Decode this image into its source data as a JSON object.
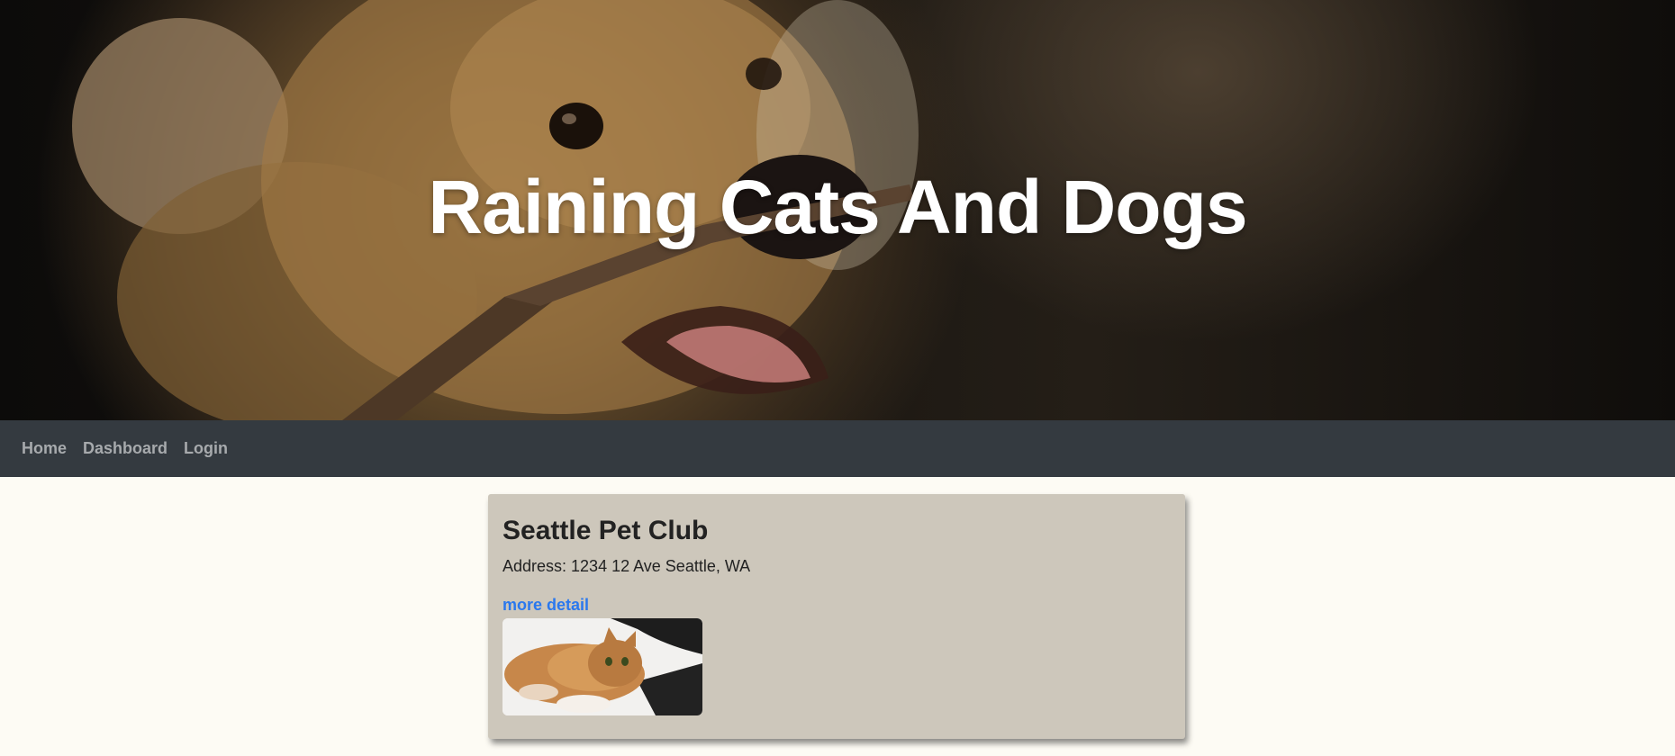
{
  "hero": {
    "title": "Raining Cats And Dogs",
    "image": "golden-retriever-with-stick"
  },
  "nav": {
    "items": [
      {
        "label": "Home"
      },
      {
        "label": "Dashboard"
      },
      {
        "label": "Login"
      }
    ]
  },
  "card": {
    "title": "Seattle Pet Club",
    "address": "Address: 1234 12 Ave Seattle, WA",
    "link_label": "more detail",
    "image": "orange-tabby-cat-lying"
  },
  "colors": {
    "navbar": "#343a40",
    "page_background": "#fdfbf4",
    "card_background": "#cdc7bb",
    "link": "#2a78ee"
  }
}
